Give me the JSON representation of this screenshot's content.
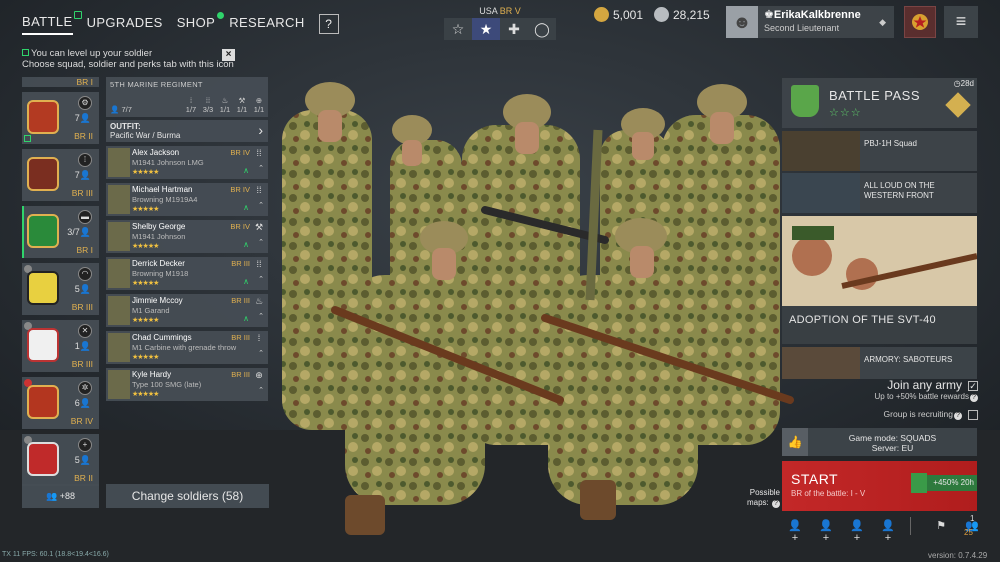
{
  "nav": {
    "tabs": [
      "BATTLE",
      "UPGRADES",
      "SHOP",
      "RESEARCH"
    ],
    "help": "?"
  },
  "hint": {
    "line1": "You can level up your soldier",
    "line2": "Choose squad, soldier and perks tab with this icon",
    "close": "×"
  },
  "nation": {
    "name": "USA",
    "br": "BR V"
  },
  "currency": {
    "gold": "5,001",
    "silver": "28,215"
  },
  "profile": {
    "name": "ErikaKalkbrenne",
    "rank": "Second Lieutenant"
  },
  "squads": [
    {
      "count": "",
      "br": "BR I"
    },
    {
      "count": "7",
      "br": "BR II"
    },
    {
      "count": "7",
      "br": "BR III"
    },
    {
      "count": "3/7",
      "br": "BR I"
    },
    {
      "count": "5",
      "br": "BR III"
    },
    {
      "count": "1",
      "br": "BR III"
    },
    {
      "count": "6",
      "br": "BR IV"
    },
    {
      "count": "5",
      "br": "BR II"
    }
  ],
  "add_squad": "+88",
  "regiment": {
    "title": "5TH MARINE REGIMENT",
    "count": "7/7",
    "slots": [
      "1/7",
      "3/3",
      "1/1",
      "1/1",
      "1/1"
    ]
  },
  "outfit": {
    "label": "OUTFIT:",
    "value": "Pacific War / Burma"
  },
  "soldiers": [
    {
      "name": "Alex Jackson",
      "weapon": "M1941 Johnson LMG",
      "br": "BR IV",
      "stars": "★★★★★"
    },
    {
      "name": "Michael Hartman",
      "weapon": "Browning M1919A4",
      "br": "BR IV",
      "stars": "★★★★★"
    },
    {
      "name": "Shelby George",
      "weapon": "M1941 Johnson",
      "br": "BR IV",
      "stars": "★★★★★"
    },
    {
      "name": "Derrick Decker",
      "weapon": "Browning M1918",
      "br": "BR III",
      "stars": "★★★★★"
    },
    {
      "name": "Jimmie Mccoy",
      "weapon": "M1 Garand",
      "br": "BR III",
      "stars": "★★★★★"
    },
    {
      "name": "Chad Cummings",
      "weapon": "M1 Carbine with grenade throw",
      "br": "BR III",
      "stars": "★★★★★"
    },
    {
      "name": "Kyle Hardy",
      "weapon": "Type 100 SMG (late)",
      "br": "BR III",
      "stars": "★★★★★"
    }
  ],
  "change_soldiers": "Change soldiers (58)",
  "battle_pass": {
    "title": "BATTLE PASS",
    "stars": "☆☆☆",
    "days": "28d"
  },
  "bp_items": [
    "PBJ-1H Squad",
    "ALL LOUD ON THE WESTERN FRONT"
  ],
  "news": {
    "caption": "ADOPTION OF THE SVT-40",
    "armory": "ARMORY: SABOTEURS"
  },
  "join": {
    "label": "Join any army",
    "sub": "Up to +50% battle rewards",
    "recruit": "Group is recruiting"
  },
  "mode": {
    "line1": "Game mode: SQUADS",
    "line2": "Server: EU"
  },
  "start": {
    "label": "START",
    "sub": "BR of the battle: I - V",
    "xp": "+450% 20h"
  },
  "maps": {
    "line1": "Possible",
    "line2": "maps:"
  },
  "group": {
    "count1": "1",
    "count25": "25"
  },
  "version": "version: 0.7.4.29",
  "fps": "TX 11 FPS: 60.1 (18.8<19.4<16.6)"
}
